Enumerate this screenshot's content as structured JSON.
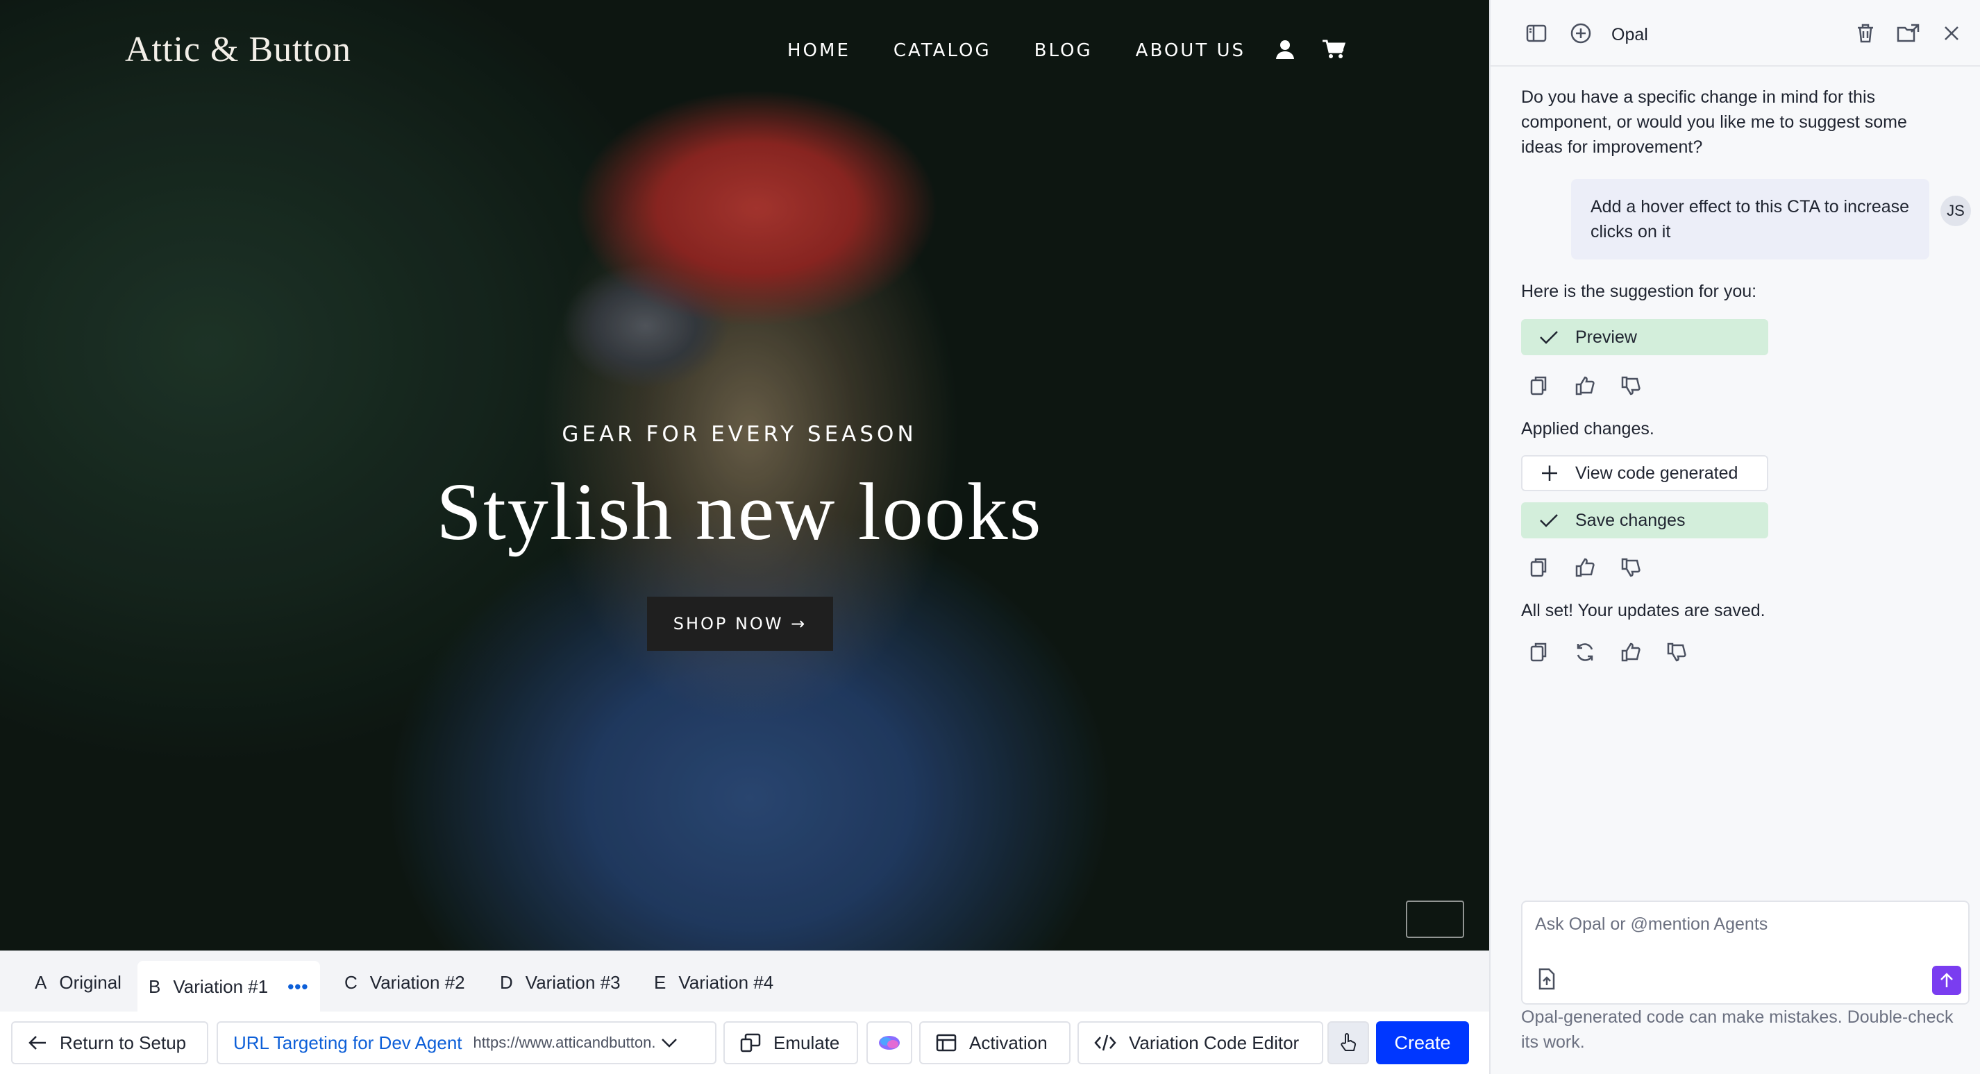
{
  "site": {
    "logo": "Attic & Button",
    "nav": [
      "HOME",
      "CATALOG",
      "BLOG",
      "ABOUT US"
    ],
    "hero_kicker": "GEAR FOR EVERY SEASON",
    "hero_title": "Stylish new looks",
    "cta_label": "SHOP NOW →"
  },
  "variations": [
    {
      "letter": "A",
      "label": "Original"
    },
    {
      "letter": "B",
      "label": "Variation #1",
      "more": "•••"
    },
    {
      "letter": "C",
      "label": "Variation #2"
    },
    {
      "letter": "D",
      "label": "Variation #3"
    },
    {
      "letter": "E",
      "label": "Variation #4"
    }
  ],
  "toolbar": {
    "return_label": "Return to Setup",
    "url_targeting_label": "URL Targeting for Dev Agent",
    "url_value": "https://www.atticandbutton.",
    "emulate_label": "Emulate",
    "activation_label": "Activation",
    "code_editor_label": "Variation Code Editor",
    "create_label": "Create"
  },
  "panel": {
    "title": "Opal",
    "assistant_question": "Do you have a specific change in mind for this component, or would you like me to suggest some ideas for improvement?",
    "user_message": "Add a hover effect to this CTA to increase clicks on it",
    "user_initials": "JS",
    "suggestion_intro": "Here is the suggestion for you:",
    "preview_label": "Preview",
    "applied_text": "Applied changes.",
    "view_code_label": "View code generated",
    "save_label": "Save changes",
    "saved_text": "All set! Your updates are saved.",
    "input_placeholder": "Ask Opal or @mention Agents",
    "disclaimer": "Opal-generated code can make mistakes. Double-check its work."
  },
  "colors": {
    "accent_blue": "#0037ff",
    "link_blue": "#0d5fd8",
    "success_chip": "#d3eedb",
    "send_purple": "#7a3df0"
  }
}
